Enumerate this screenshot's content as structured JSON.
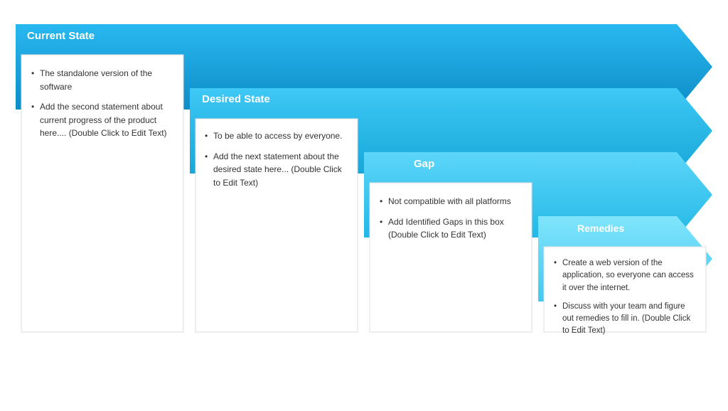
{
  "diagram": {
    "bands": [
      {
        "id": "current-state",
        "title": "Current State",
        "color_dark": "#1a9cd8",
        "color_light": "#2ab0e8",
        "items": [
          "The standalone version of the software",
          "Add the second statement about current progress of the product here.... (Double Click to Edit Text)"
        ]
      },
      {
        "id": "desired-state",
        "title": "Desired State",
        "color_dark": "#1ab5e0",
        "color_light": "#3ecbf5",
        "items": [
          "To be able to access by everyone.",
          "Add the next statement about the desired state here...    (Double Click to Edit Text)"
        ]
      },
      {
        "id": "gap",
        "title": "Gap",
        "color_dark": "#22c5ee",
        "color_light": "#5dd8f8",
        "items": [
          "Not compatible with all platforms",
          "Add Identified Gaps in this box (Double Click to Edit Text)"
        ]
      },
      {
        "id": "remedies",
        "title": "Remedies",
        "color_dark": "#44d4f5",
        "color_light": "#80e5fc",
        "items": [
          "Create a web version of the application, so everyone  can access it over the internet.",
          "Discuss with your team and figure out  remedies to fill in. (Double Click to Edit Text)"
        ]
      }
    ]
  }
}
